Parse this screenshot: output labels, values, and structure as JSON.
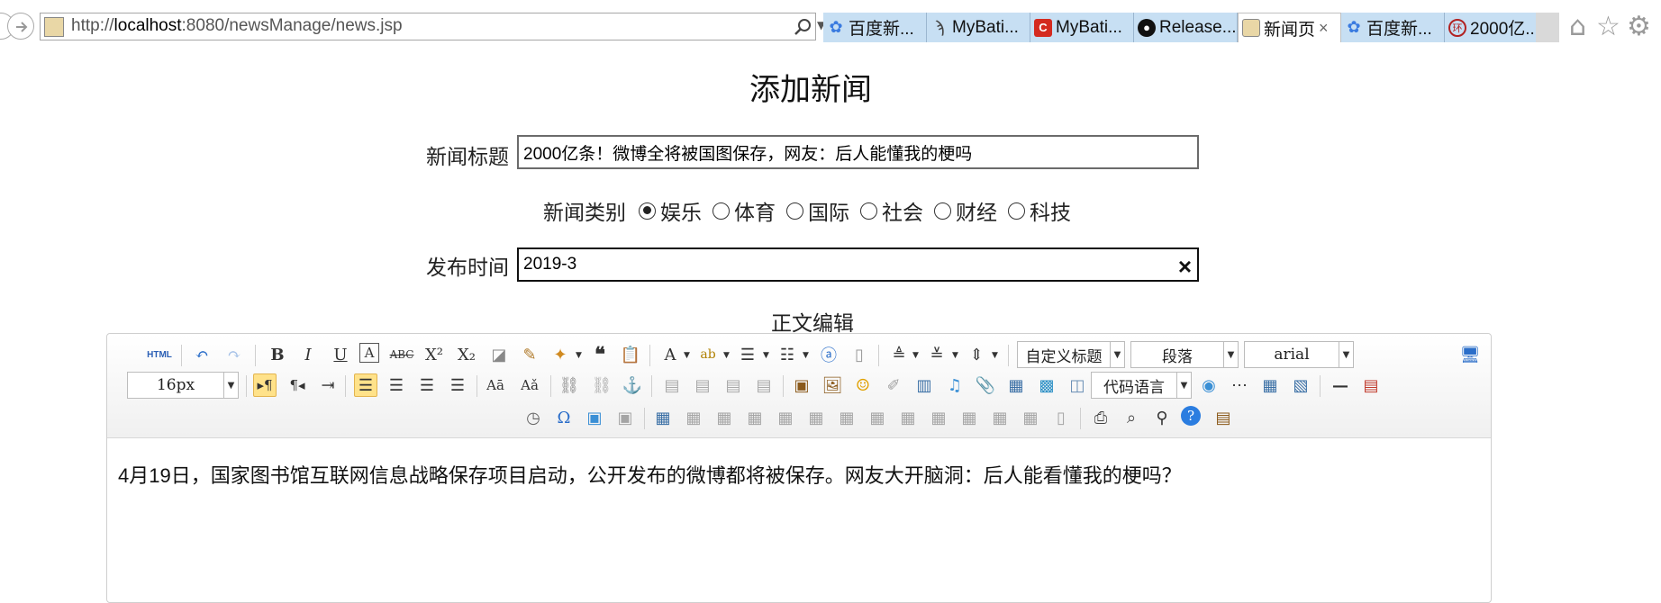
{
  "browser": {
    "url_prefix": "http://",
    "url_host": "localhost",
    "url_rest": ":8080/newsManage/news.jsp",
    "tabs": [
      {
        "label": "百度新...",
        "icon": "baidu-paw-icon",
        "color": "#3a7be0"
      },
      {
        "label": "MyBati...",
        "icon": "mybatis-bird-icon",
        "color": "#444444"
      },
      {
        "label": "MyBati...",
        "icon": "csdn-c-icon",
        "color": "#d42a1f"
      },
      {
        "label": "Release...",
        "icon": "github-icon",
        "color": "#111111"
      },
      {
        "label": "新闻页",
        "icon": "site-thumbnail-icon",
        "color": "#c8a14a",
        "active": true
      },
      {
        "label": "百度新...",
        "icon": "baidu-paw-icon",
        "color": "#3a7be0"
      },
      {
        "label": "2000亿...",
        "icon": "huanqiu-icon",
        "color": "#b22222"
      }
    ]
  },
  "form": {
    "page_title": "添加新闻",
    "title_label": "新闻标题",
    "title_value": "2000亿条！微博全将被国图保存，网友：后人能懂我的梗吗",
    "category_label": "新闻类别",
    "categories": [
      {
        "label": "娱乐",
        "checked": true
      },
      {
        "label": "体育",
        "checked": false
      },
      {
        "label": "国际",
        "checked": false
      },
      {
        "label": "社会",
        "checked": false
      },
      {
        "label": "财经",
        "checked": false
      },
      {
        "label": "科技",
        "checked": false
      }
    ],
    "date_label": "发布时间",
    "date_value": "2019-3",
    "editor_label": "正文编辑"
  },
  "editor": {
    "custom_heading": "自定义标题",
    "paragraph": "段落",
    "font_family": "arial",
    "font_size": "16px",
    "code_language": "代码语言",
    "source_label": "HTML",
    "body_text": "4月19日，国家图书馆互联网信息战略保存项目启动，公开发布的微博都将被保存。网友大开脑洞：后人能看懂我的梗吗？"
  }
}
